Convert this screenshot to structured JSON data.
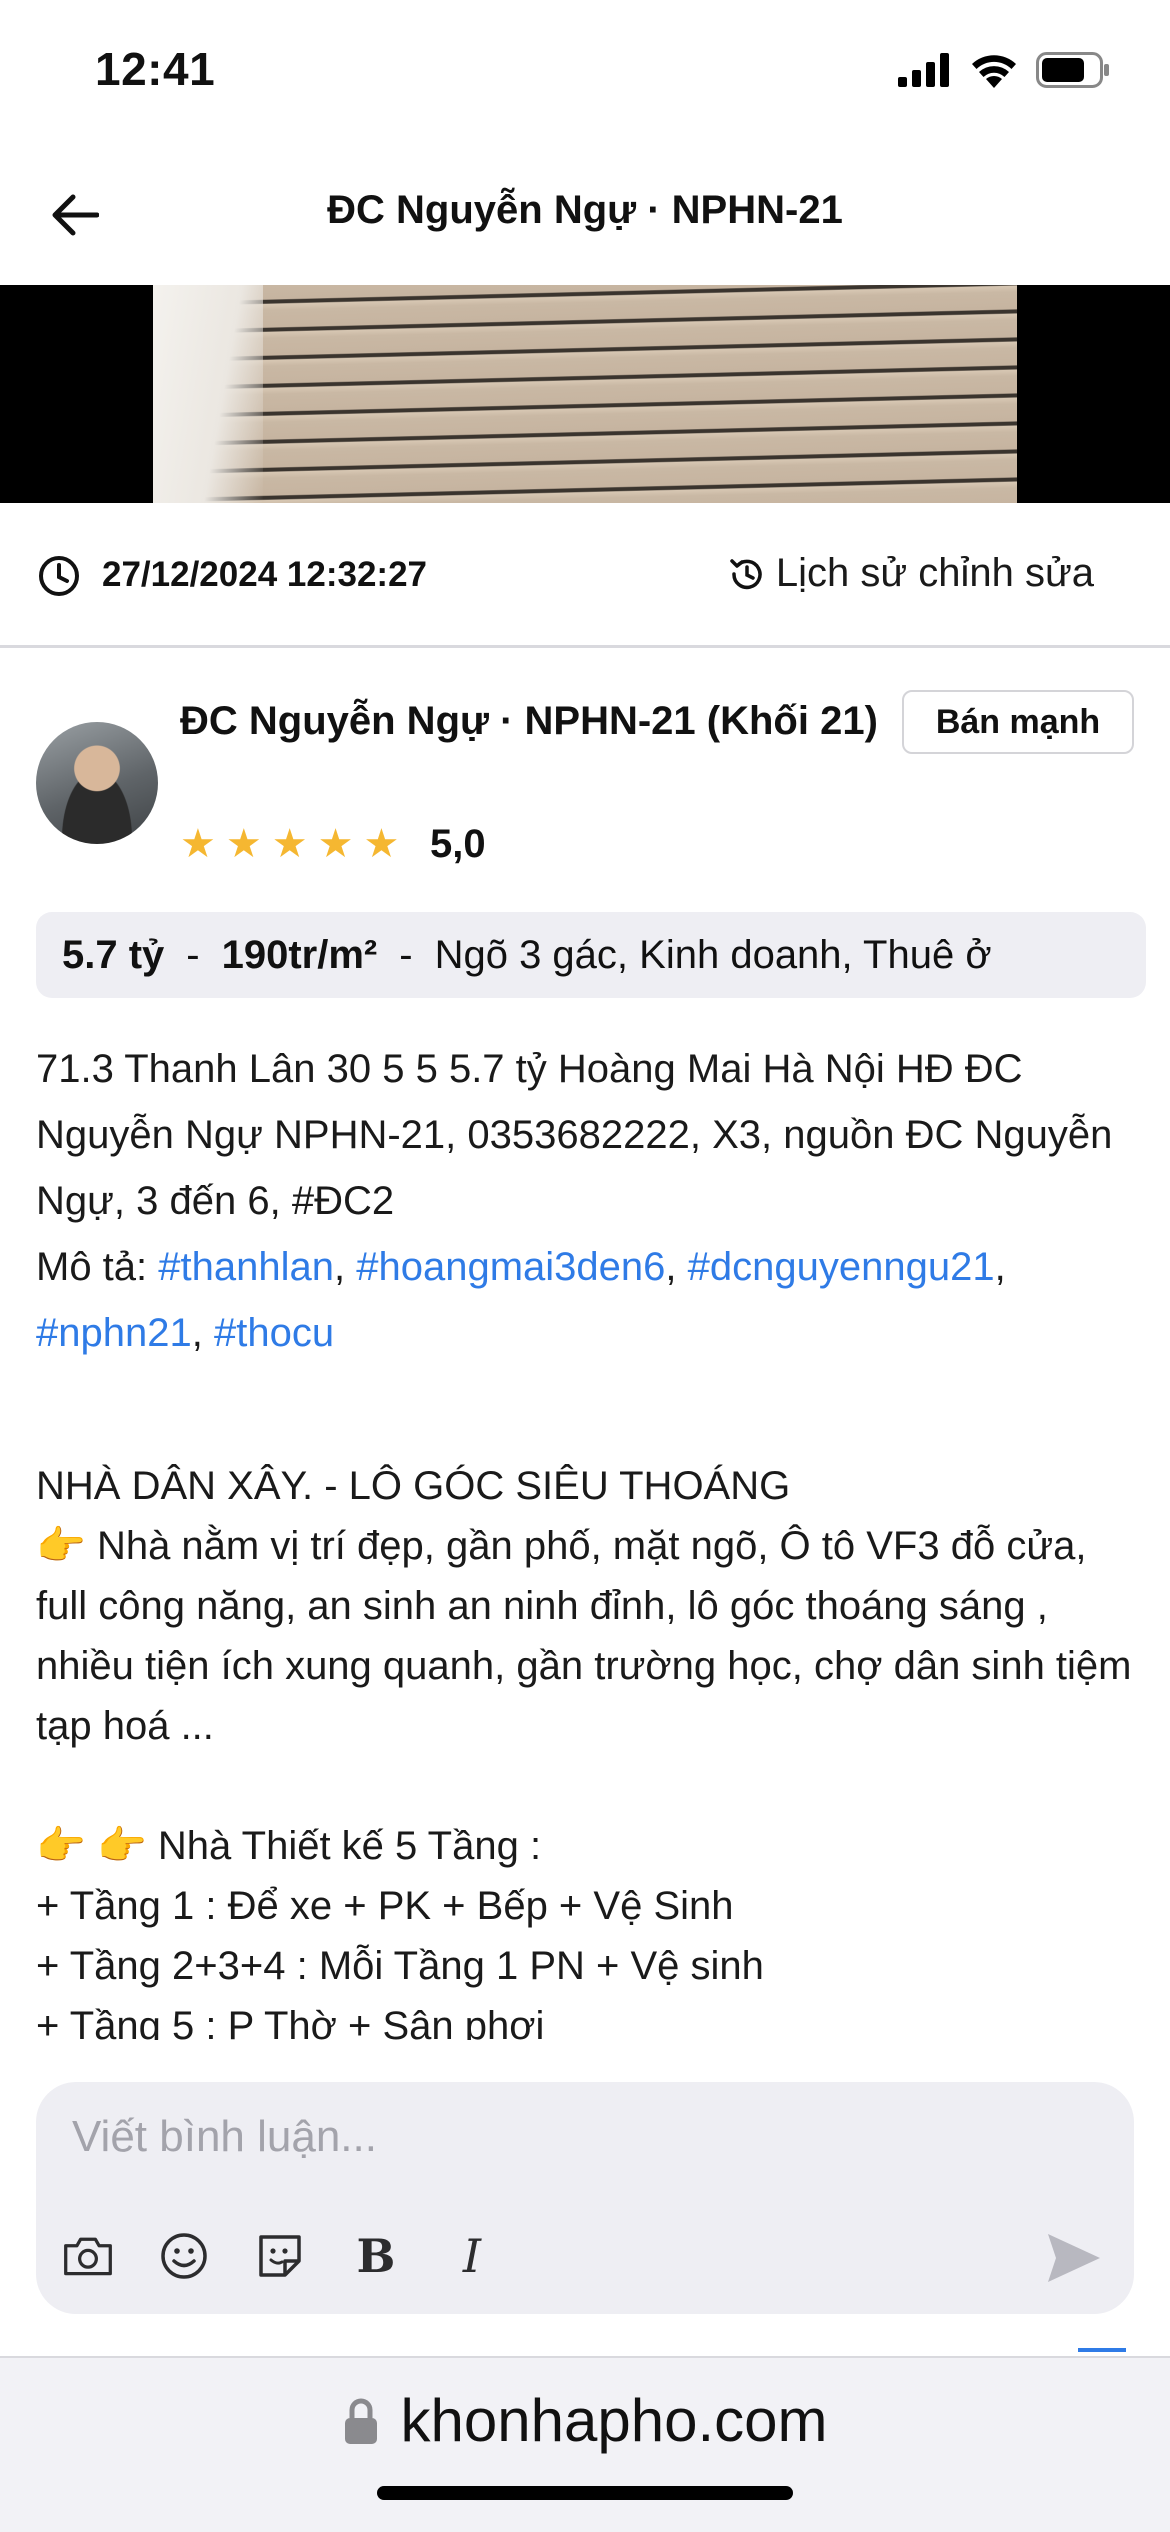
{
  "status_bar": {
    "time": "12:41"
  },
  "header": {
    "title": "ĐC Nguyễn Ngự · NPHN-21"
  },
  "meta": {
    "date": "27/12/2024 12:32:27",
    "history_label": "Lịch sử chỉnh sửa"
  },
  "author": {
    "name": "ĐC Nguyễn Ngự · NPHN-21 (Khối 21)",
    "badge": "Bán mạnh",
    "rating": "5,0",
    "stars": 5
  },
  "price": {
    "total": "5.7 tỷ",
    "dash1": "-",
    "per_m2": "190tr/m²",
    "dash2": "-",
    "tags": "Ngõ 3 gác, Kinh doanh, Thuê ở"
  },
  "description": {
    "text": "71.3 Thanh Lân 30 5 5 5.7 tỷ Hoàng Mai Hà Nội HĐ ĐC Nguyễn Ngự NPHN-21, 0353682222, X3, nguồn ĐC Nguyễn Ngự, 3 đến 6, #ĐC2",
    "label": "Mô tả:",
    "hashtags": [
      "#thanhlan",
      "#hoangmai3den6",
      "#dcnguyenngu21",
      "#nphn21",
      "#thocu"
    ]
  },
  "listing": {
    "headline": "NHÀ DÂN XÂY. - LÔ GÓC SIÊU THOÁNG",
    "hand": "👉",
    "intro": "Nhà nằm vị trí đẹp, gần phố, mặt ngõ, Ô tô VF3 đỗ cửa, full công năng, an sinh an ninh đỉnh, lô góc thoáng sáng , nhiều tiện ích xung quanh, gần trường học, chợ dân sinh tiệm tạp hoá ...",
    "design_title": "Nhà Thiết kế 5 Tầng :",
    "floors": [
      "+ Tầng 1 : Để xe + PK + Bếp + Vệ Sinh",
      "+ Tầng 2+3+4 : Mỗi Tầng 1 PN + Vệ sinh",
      "+ Tầng 5 : P Thờ + Sân phơi"
    ]
  },
  "comment": {
    "placeholder": "Viết bình luận..."
  },
  "url_bar": {
    "domain": "khonhapho.com"
  },
  "colors": {
    "accent": "#2f7be6",
    "star": "#f5b731",
    "pill_bg": "#eeeef3"
  }
}
